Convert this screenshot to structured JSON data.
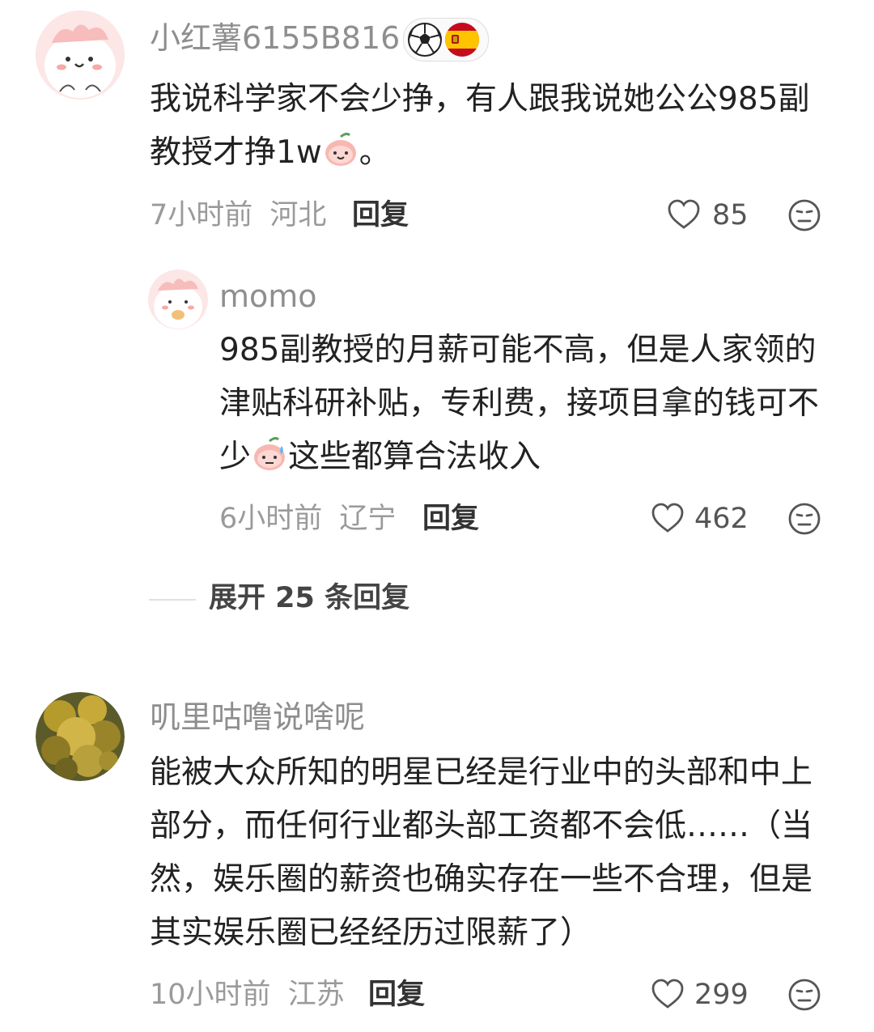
{
  "comments": [
    {
      "username": "小红薯6155B816",
      "text_a": "我说科学家不会少挣，有人跟我说她公公985副教授才挣1w",
      "text_b": "。",
      "emoji": "peach-smile-emoji",
      "time": "7小时前",
      "location": "河北",
      "reply_label": "回复",
      "likes": "85"
    },
    {
      "username": "momo",
      "text_a": "985副教授的月薪可能不高，但是人家领的津贴科研补贴，专利费，接项目拿的钱可不少",
      "text_b": "这些都算合法收入",
      "emoji": "peach-sweat-emoji",
      "time": "6小时前",
      "location": "辽宁",
      "reply_label": "回复",
      "likes": "462"
    },
    {
      "username": "叽里咕噜说啥呢",
      "text_a": "能被大众所知的明星已经是行业中的头部和中上部分，而任何行业都头部工资都不会低……（当然，娱乐圈的薪资也确实存在一些不合理，但是其实娱乐圈已经经历过限薪了）",
      "time": "10小时前",
      "location": "江苏",
      "reply_label": "回复",
      "likes": "299"
    }
  ],
  "expand_replies": "展开 25 条回复",
  "badge_icons": [
    "soccer-ball-icon",
    "spain-flag-icon"
  ],
  "colors": {
    "username": "#8e8e8e",
    "meta": "#9a9a9a",
    "text": "#222222"
  }
}
